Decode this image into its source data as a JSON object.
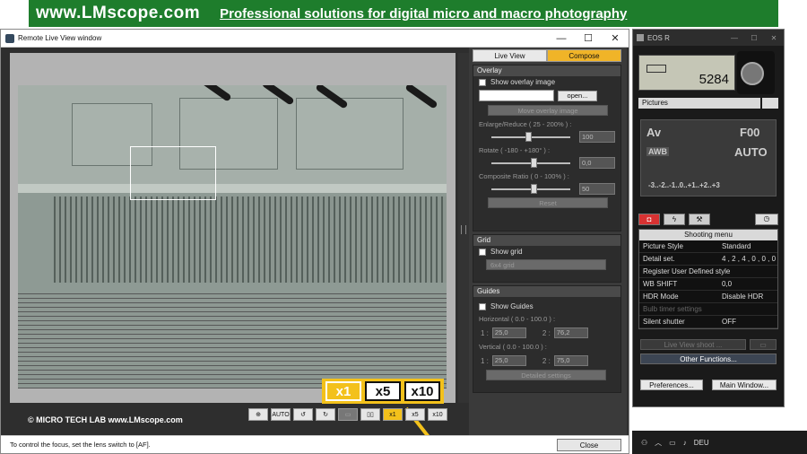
{
  "banner": {
    "url": "www.LMscope.com",
    "tagline": "Professional solutions for digital micro and macro photography"
  },
  "live_window": {
    "title": "Remote Live View window",
    "controls": {
      "minimize": "—",
      "maximize": "☐",
      "close": "✕"
    },
    "tabs": [
      {
        "label": "Live View",
        "active": false
      },
      {
        "label": "Compose",
        "active": true
      }
    ],
    "overlay": {
      "header": "Overlay",
      "show_overlay": "Show overlay image",
      "open_button": "open...",
      "move_button": "Move overlay image",
      "enlarge_label": "Enlarge/Reduce ( 25 - 200% ) :",
      "enlarge_value": "100",
      "rotate_label": "Rotate ( -180 - +180° ) :",
      "rotate_value": "0,0",
      "composite_label": "Composite Ratio ( 0 - 100% ) :",
      "composite_value": "50",
      "reset_button": "Reset"
    },
    "grid": {
      "header": "Grid",
      "show_grid": "Show grid",
      "grid_select": "6x4 grid"
    },
    "guides": {
      "header": "Guides",
      "show_guides": "Show Guides",
      "horizontal_label": "Horizontal ( 0.0 - 100.0 ) :",
      "h1_label": "1 :",
      "h1_value": "25,0",
      "h2_label": "2 :",
      "h2_value": "76,2",
      "vertical_label": "Vertical ( 0.0 - 100.0 ) :",
      "v1_label": "1 :",
      "v1_value": "25,0",
      "v2_label": "2 :",
      "v2_value": "75,0",
      "detailed_button": "Detailed settings"
    },
    "zoom": {
      "x1": "x1",
      "x5": "x5",
      "x10": "x10"
    },
    "toolbar": {
      "wb": "⊕",
      "auto": "AUTO",
      "rot_left": "↺",
      "rot_right": "↻",
      "guides": "▯▯",
      "g_drop": "▾",
      "x1": "x1",
      "x5": "x5",
      "x10": "x10"
    },
    "brand": "©  MICRO TECH LAB    www.LMscope.com",
    "status": "To control the focus, set the lens switch to [AF].",
    "close_button": "Close"
  },
  "eos": {
    "title": "EOS R",
    "controls": {
      "minimize": "—",
      "maximize": "☐",
      "close": "✕"
    },
    "shots": "5284",
    "pictures": "Pictures",
    "settings": {
      "mode": "Av",
      "aperture": "F00",
      "wb": "AWB",
      "iso": "AUTO",
      "exposure": "-3..-2..-1..0..+1..+2..+3"
    },
    "menu": {
      "header": "Shooting menu",
      "rows": [
        {
          "k": "Picture Style",
          "v": "Standard",
          "dis": false
        },
        {
          "k": "  Detail set.",
          "v": "4 , 2 , 4 , 0 , 0 , 0",
          "dis": false
        },
        {
          "k": "  Register User Defined style",
          "v": "",
          "dis": false
        },
        {
          "k": "WB SHIFT",
          "v": "0,0",
          "dis": false
        },
        {
          "k": "HDR Mode",
          "v": "Disable HDR",
          "dis": false
        },
        {
          "k": "Bulb timer settings",
          "v": "",
          "dis": true
        },
        {
          "k": "Silent shutter",
          "v": "OFF",
          "dis": false
        }
      ]
    },
    "live_view_shoot": "Live View shoot ...",
    "other_functions": "Other Functions...",
    "preferences": "Preferences...",
    "main_window": "Main Window..."
  },
  "taskbar": {
    "lang": "DEU"
  }
}
